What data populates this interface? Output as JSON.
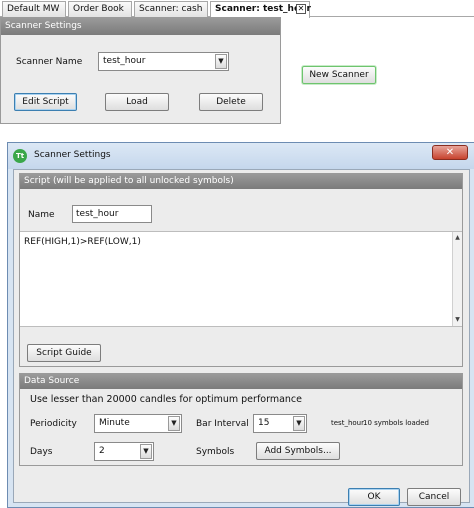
{
  "tabs": [
    {
      "label": "Default MW",
      "active": false
    },
    {
      "label": "Order Book",
      "active": false
    },
    {
      "label": "Scanner: cash",
      "active": false
    },
    {
      "label": "Scanner: test_hour",
      "active": true
    }
  ],
  "tab_close_icon": "close-icon",
  "top_panel": {
    "title": "Scanner Settings",
    "scanner_name_label": "Scanner Name",
    "scanner_name_value": "test_hour",
    "edit_script": "Edit Script",
    "load": "Load",
    "delete": "Delete",
    "new_scanner": "New Scanner"
  },
  "dialog": {
    "title": "Scanner Settings",
    "app_icon_text": "Tt",
    "close_icon": "✕",
    "script_group": {
      "title": "Script (will be applied to all unlocked symbols)",
      "name_label": "Name",
      "name_value": "test_hour",
      "script_text": "REF(HIGH,1)>REF(LOW,1)",
      "script_guide": "Script Guide"
    },
    "data_source": {
      "title": "Data Source",
      "use_checkbox_label": "Use lesser than 20000 candles for optimum performance",
      "periodicity_label": "Periodicity",
      "periodicity_value": "Minute",
      "bar_interval_label": "Bar Interval",
      "bar_interval_value": "15",
      "days_label": "Days",
      "days_value": "2",
      "symbols_label": "Symbols",
      "add_symbols": "Add Symbols...",
      "symbols_info_name": "test_hour",
      "symbols_info_count": "10 symbols loaded"
    },
    "ok": "OK",
    "cancel": "Cancel"
  },
  "colors": {
    "panel_header": "#8a8a8a",
    "dialog_frame": "#c5d7ec",
    "close_button": "#c7422e",
    "new_scanner_border": "#6ec46e"
  }
}
